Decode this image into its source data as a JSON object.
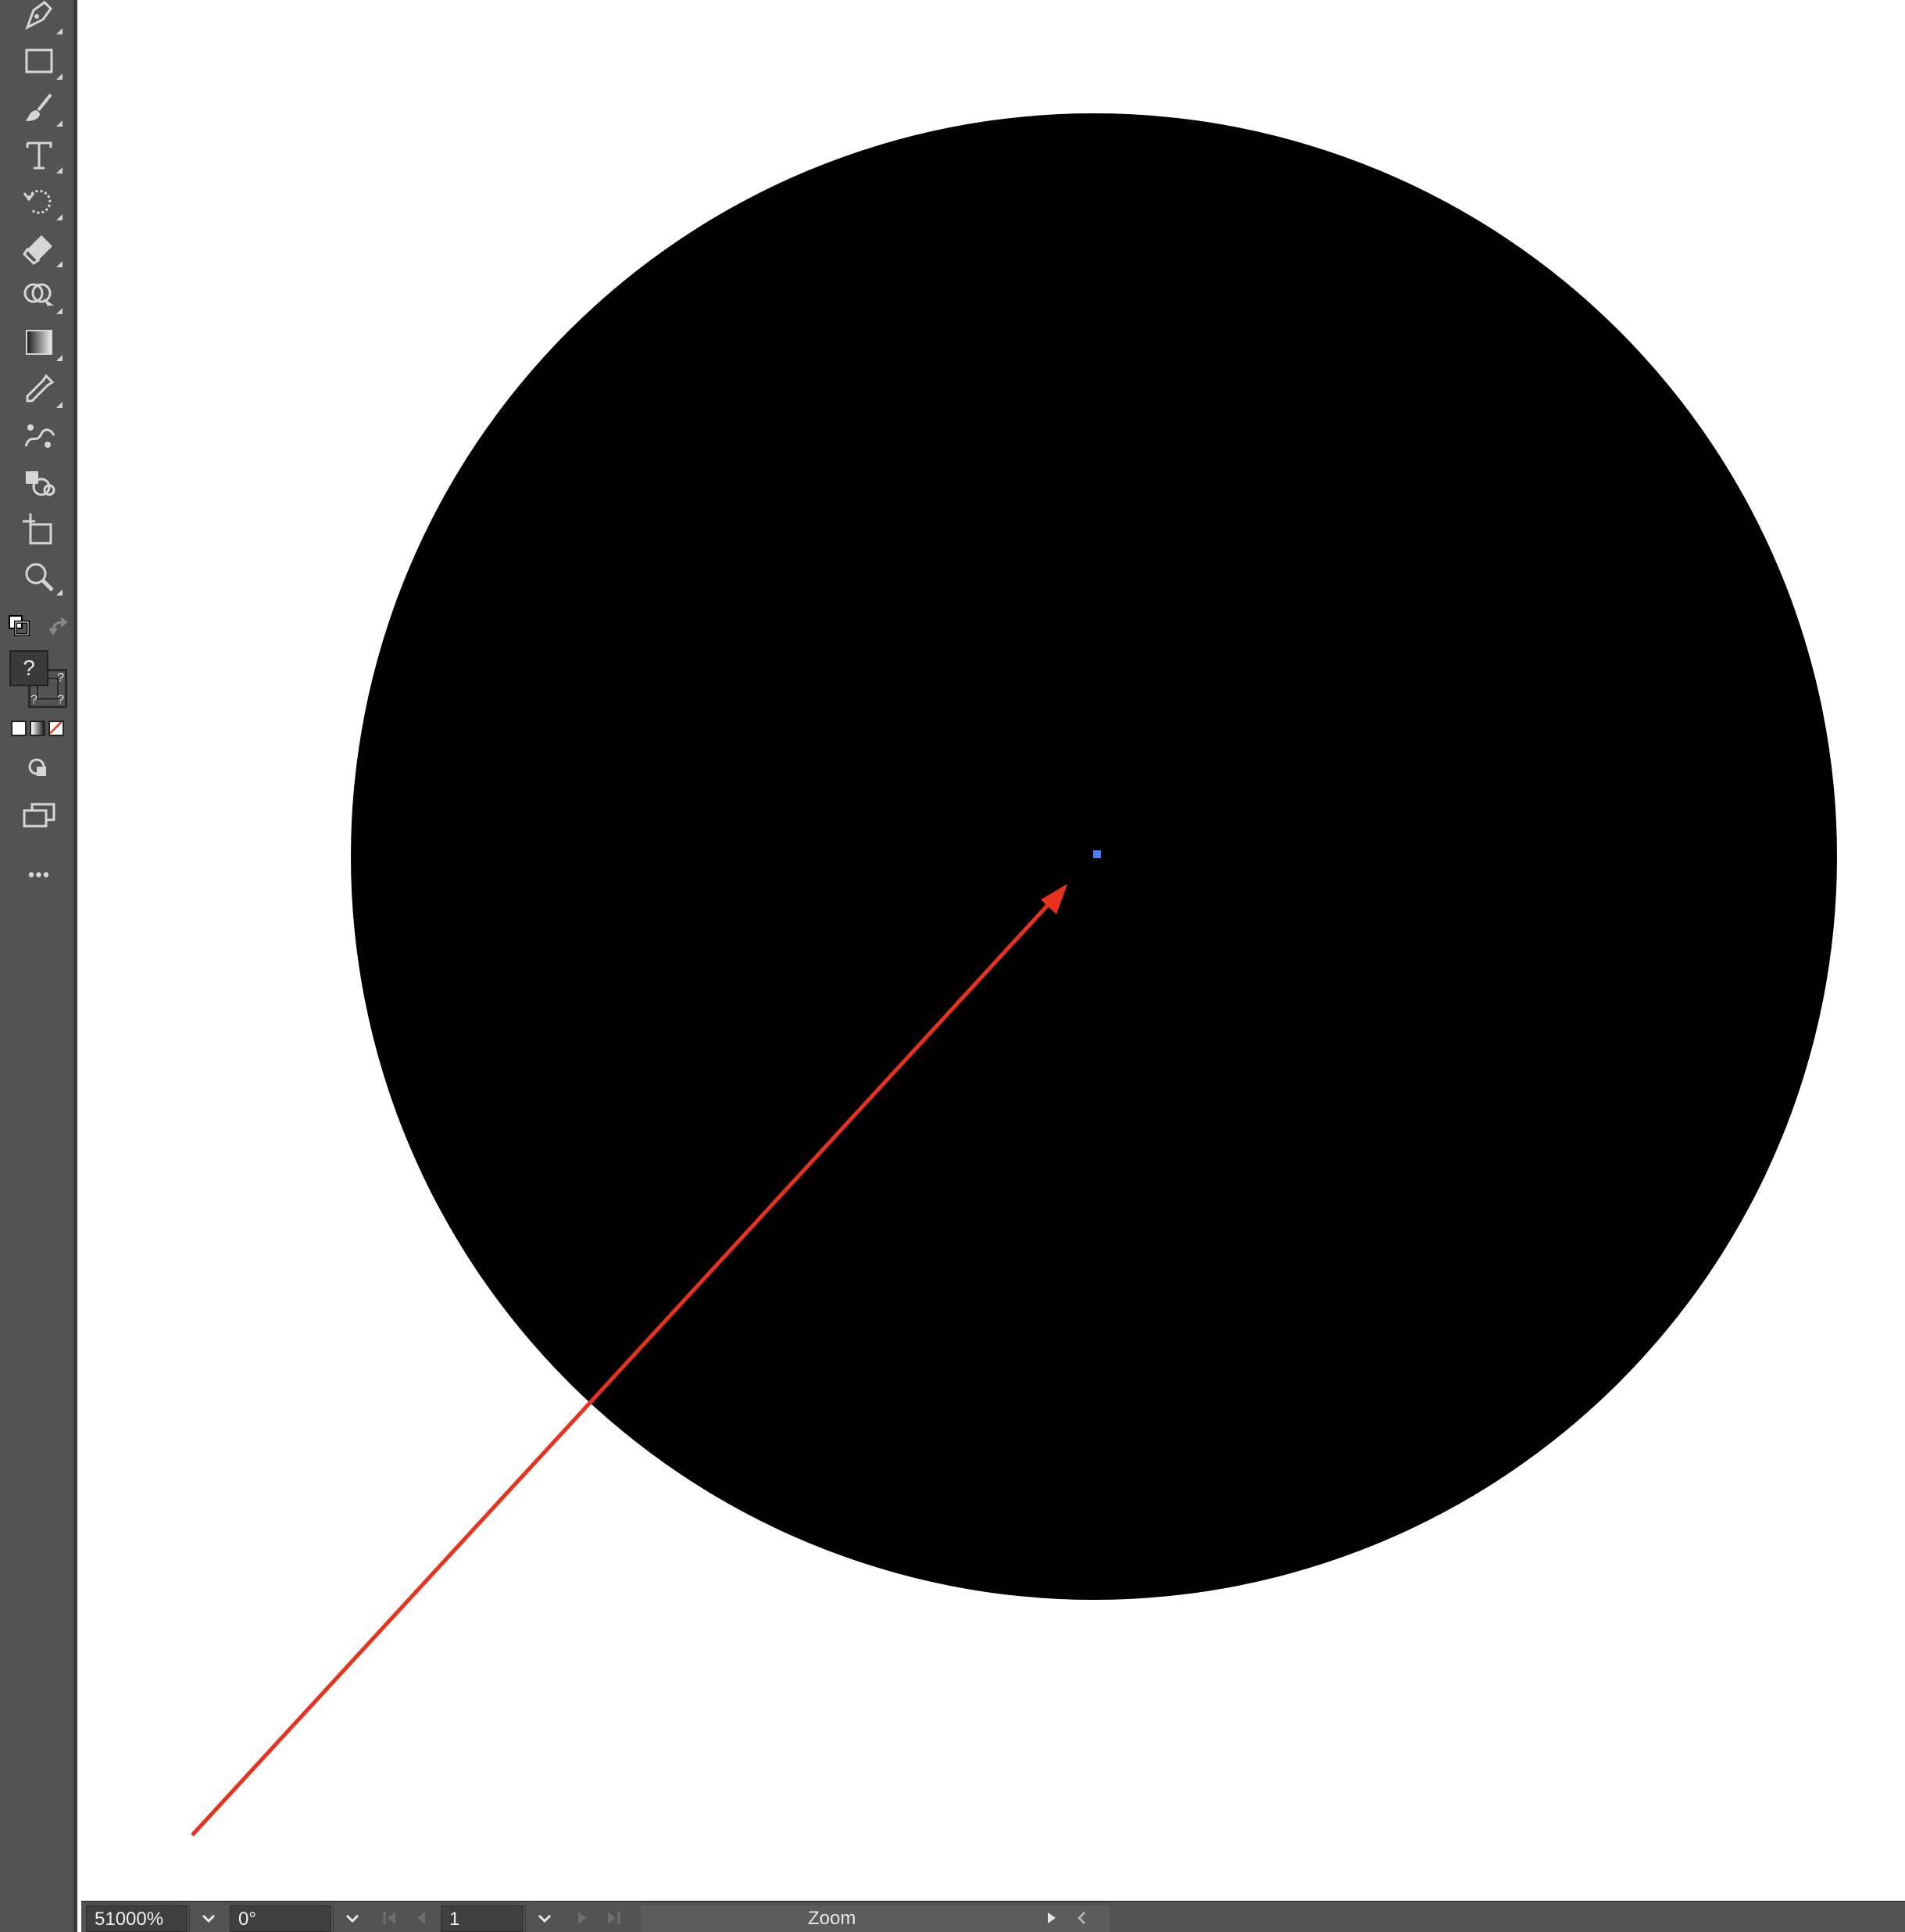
{
  "toolbar": {
    "tools": [
      {
        "name": "pen-tool",
        "icon": "pen-icon"
      },
      {
        "name": "rectangle-tool",
        "icon": "rectangle-icon"
      },
      {
        "name": "paintbrush-tool",
        "icon": "paintbrush-icon"
      },
      {
        "name": "type-tool",
        "icon": "type-icon"
      },
      {
        "name": "rotate-tool",
        "icon": "rotate-icon"
      },
      {
        "name": "eraser-tool",
        "icon": "eraser-icon"
      },
      {
        "name": "shape-builder-tool",
        "icon": "shape-builder-icon"
      },
      {
        "name": "gradient-tool",
        "icon": "gradient-icon"
      },
      {
        "name": "eyedropper-tool",
        "icon": "eyedropper-icon"
      },
      {
        "name": "puppet-warp-tool",
        "icon": "puppet-warp-icon"
      },
      {
        "name": "live-paint-tool",
        "icon": "live-paint-icon"
      },
      {
        "name": "artboard-tool",
        "icon": "artboard-icon"
      },
      {
        "name": "zoom-tool",
        "icon": "zoom-icon"
      }
    ],
    "fill_unknown": "?",
    "stroke_unknown": "?",
    "more_label": "•••"
  },
  "statusbar": {
    "zoom_value": "51000%",
    "rotation_value": "0°",
    "artboard_value": "1",
    "mode_label": "Zoom"
  },
  "colors": {
    "toolbar_bg": "#535353",
    "canvas_bg": "#ffffff",
    "object_fill": "#000000",
    "anchor_point": "#4f7bff",
    "annotation_arrow": "#e8321e"
  }
}
